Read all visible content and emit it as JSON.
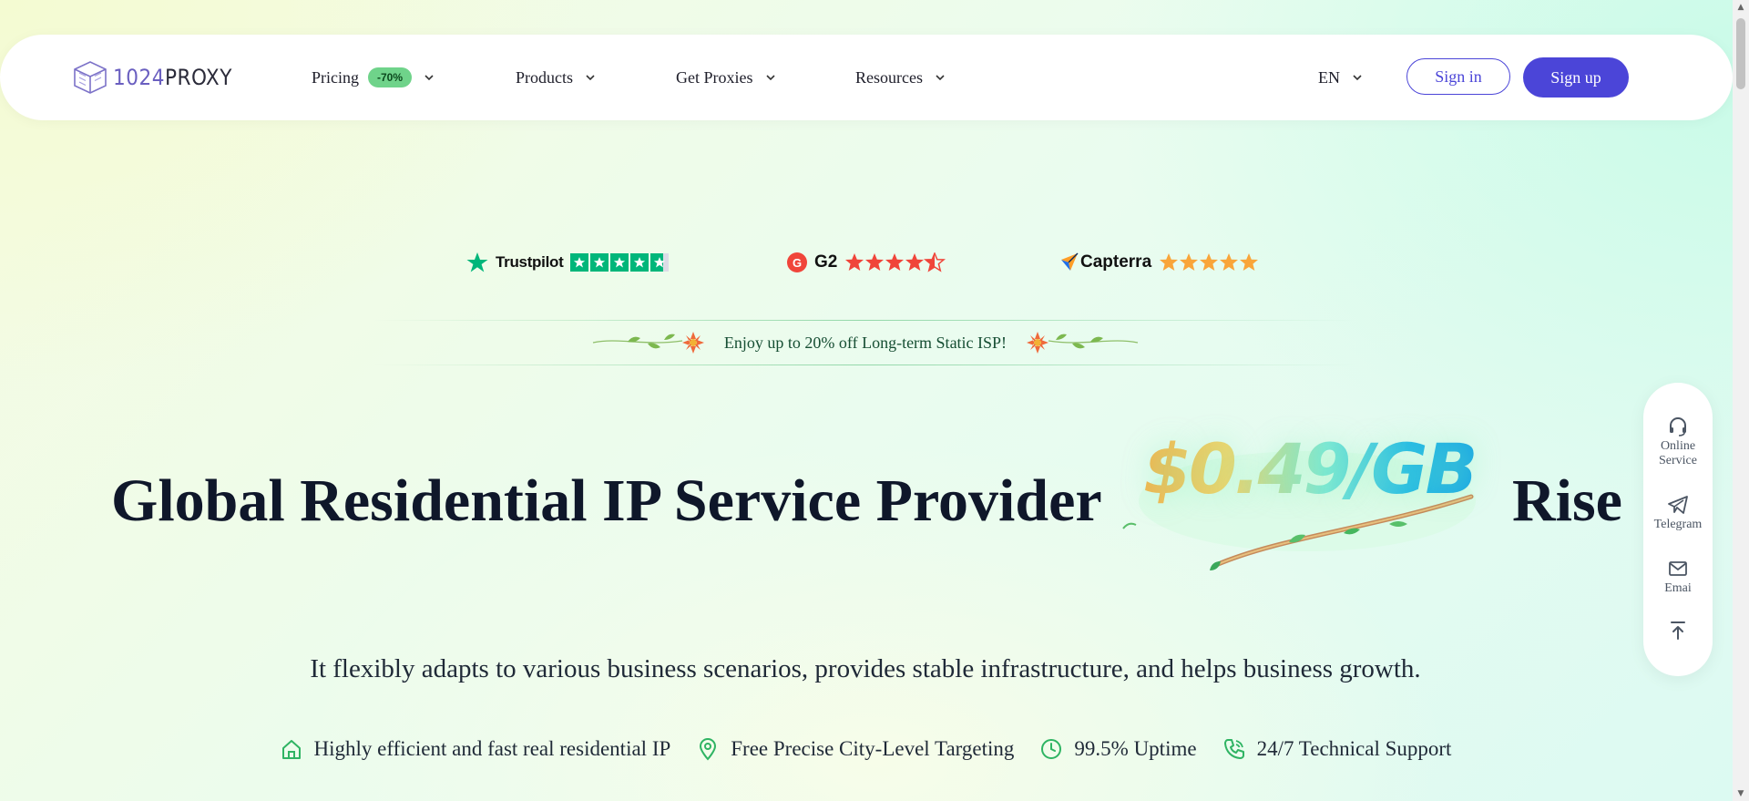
{
  "nav": {
    "logo_num": "1024",
    "logo_word": "PROXY",
    "pricing_label": "Pricing",
    "pricing_badge": "-70%",
    "products_label": "Products",
    "get_proxies_label": "Get Proxies",
    "resources_label": "Resources",
    "language": "EN",
    "signin_label": "Sign in",
    "signup_label": "Sign up"
  },
  "ratings": {
    "trustpilot": "Trustpilot",
    "g2": "G2",
    "capterra": "Capterra"
  },
  "promo": {
    "text": "Enjoy up to 20% off Long-term Static ISP!"
  },
  "hero": {
    "title": "Global Residential IP Service Provider",
    "price": "$0.49/GB",
    "rise": "Rise",
    "subtitle": "It flexibly adapts to various business scenarios, provides stable infrastructure, and helps business growth."
  },
  "features": [
    {
      "label": "Highly efficient and fast real residential IP",
      "icon": "home-icon"
    },
    {
      "label": "Free Precise City-Level Targeting",
      "icon": "location-pin-icon"
    },
    {
      "label": "99.5% Uptime",
      "icon": "clock-icon"
    },
    {
      "label": "24/7 Technical Support",
      "icon": "phone-icon"
    }
  ],
  "side": {
    "online_service": "Online Service",
    "telegram": "Telegram",
    "email": "Emai"
  },
  "colors": {
    "accent": "#4b45d8",
    "green": "#2fb463",
    "trustpilot_green": "#00b67a",
    "star_orange": "#f9a53a",
    "g2_red": "#f0453a"
  }
}
